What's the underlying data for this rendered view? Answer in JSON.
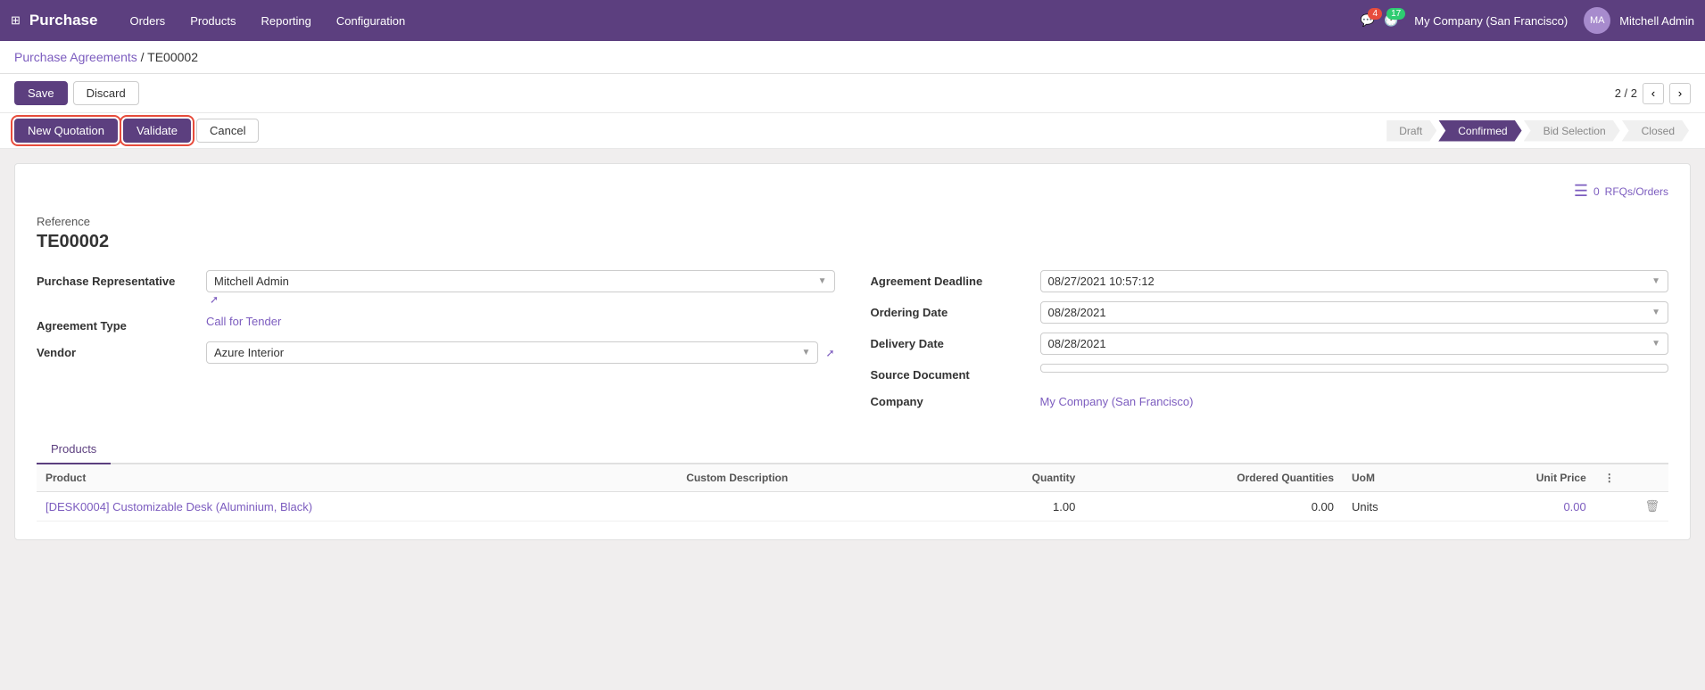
{
  "topNav": {
    "appName": "Purchase",
    "navItems": [
      "Orders",
      "Products",
      "Reporting",
      "Configuration"
    ],
    "notifications": {
      "chat": "4",
      "clock": "17"
    },
    "company": "My Company (San Francisco)",
    "user": "Mitchell Admin"
  },
  "breadcrumb": {
    "parent": "Purchase Agreements",
    "current": "TE00002"
  },
  "actionBar": {
    "saveLabel": "Save",
    "discardLabel": "Discard",
    "pageInfo": "2 / 2"
  },
  "statusBar": {
    "newQuotationLabel": "New Quotation",
    "validateLabel": "Validate",
    "cancelLabel": "Cancel",
    "pipeline": [
      "Draft",
      "Confirmed",
      "Bid Selection",
      "Closed"
    ],
    "activeStep": "Confirmed"
  },
  "rfqCounter": {
    "count": "0",
    "label": "RFQs/Orders"
  },
  "form": {
    "referenceLabel": "Reference",
    "referenceValue": "TE00002",
    "fields": {
      "purchaseRepLabel": "Purchase Representative",
      "purchaseRepValue": "Mitchell Admin",
      "agreementTypeLabel": "Agreement Type",
      "agreementTypeValue": "Call for Tender",
      "vendorLabel": "Vendor",
      "vendorValue": "Azure Interior",
      "agreementDeadlineLabel": "Agreement Deadline",
      "agreementDeadlineValue": "08/27/2021 10:57:12",
      "orderingDateLabel": "Ordering Date",
      "orderingDateValue": "08/28/2021",
      "deliveryDateLabel": "Delivery Date",
      "deliveryDateValue": "08/28/2021",
      "sourceDocLabel": "Source Document",
      "sourceDocValue": "",
      "companyLabel": "Company",
      "companyValue": "My Company (San Francisco)"
    }
  },
  "tabs": [
    "Products"
  ],
  "activeTab": "Products",
  "table": {
    "columns": [
      "Product",
      "Custom Description",
      "Quantity",
      "Ordered Quantities",
      "UoM",
      "Unit Price",
      ""
    ],
    "rows": [
      {
        "product": "[DESK0004] Customizable Desk (Aluminium, Black)",
        "customDescription": "",
        "quantity": "1.00",
        "orderedQuantities": "0.00",
        "uom": "Units",
        "unitPrice": "0.00"
      }
    ]
  }
}
